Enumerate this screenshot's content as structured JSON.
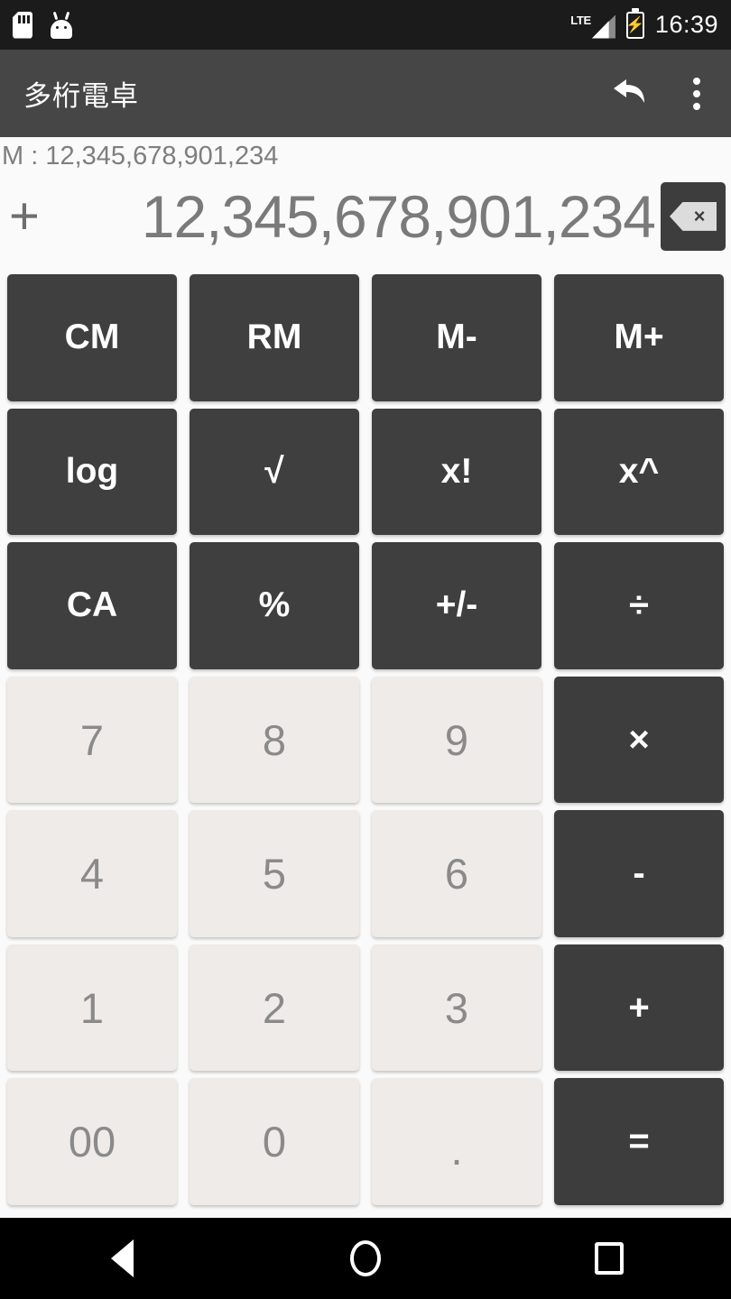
{
  "status_bar": {
    "icons_left": [
      "sd-card-icon",
      "android-head-icon"
    ],
    "network_label": "LTE",
    "battery": "charging-battery-icon",
    "time": "16:39",
    "background": "#1b1b1b"
  },
  "app_bar": {
    "title": "多桁電卓",
    "undo_label": "undo-icon",
    "overflow_label": "overflow-menu-icon",
    "background": "#464646"
  },
  "display": {
    "memory_label": "M : 12,345,678,901,234",
    "operator": "+",
    "value": "12,345,678,901,234",
    "backspace_label": "×"
  },
  "keypad": {
    "rows": [
      {
        "keys": [
          {
            "label": "CM",
            "type": "fn"
          },
          {
            "label": "RM",
            "type": "fn"
          },
          {
            "label": "M-",
            "type": "fn"
          },
          {
            "label": "M+",
            "type": "fn"
          }
        ]
      },
      {
        "keys": [
          {
            "label": "log",
            "type": "fn"
          },
          {
            "label": "√",
            "type": "fn"
          },
          {
            "label": "x!",
            "type": "fn"
          },
          {
            "label": "x^",
            "type": "fn"
          }
        ]
      },
      {
        "keys": [
          {
            "label": "CA",
            "type": "fn"
          },
          {
            "label": "%",
            "type": "fn"
          },
          {
            "label": "+/-",
            "type": "fn"
          },
          {
            "label": "÷",
            "type": "op"
          }
        ]
      },
      {
        "keys": [
          {
            "label": "7",
            "type": "num"
          },
          {
            "label": "8",
            "type": "num"
          },
          {
            "label": "9",
            "type": "num"
          },
          {
            "label": "×",
            "type": "op"
          }
        ]
      },
      {
        "keys": [
          {
            "label": "4",
            "type": "num"
          },
          {
            "label": "5",
            "type": "num"
          },
          {
            "label": "6",
            "type": "num"
          },
          {
            "label": "-",
            "type": "op"
          }
        ]
      },
      {
        "keys": [
          {
            "label": "1",
            "type": "num"
          },
          {
            "label": "2",
            "type": "num"
          },
          {
            "label": "3",
            "type": "num"
          },
          {
            "label": "+",
            "type": "op"
          }
        ]
      },
      {
        "keys": [
          {
            "label": "00",
            "type": "num"
          },
          {
            "label": "0",
            "type": "num"
          },
          {
            "label": ".",
            "type": "num dot"
          },
          {
            "label": "=",
            "type": "op"
          }
        ]
      }
    ],
    "colors": {
      "function_key": "#3f3f3f",
      "operator_key": "#3d3d3d",
      "number_key": "#efebe8",
      "number_text": "#8a8a8a",
      "background": "#fafafa"
    }
  },
  "nav_bar": {
    "back": "back-triangle-icon",
    "home": "home-circle-icon",
    "recents": "recents-square-icon"
  }
}
